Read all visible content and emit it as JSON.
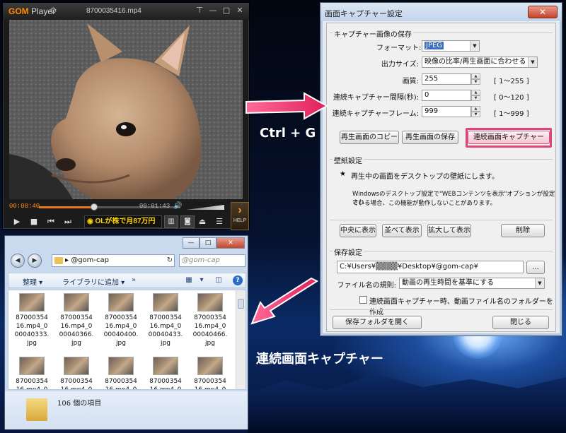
{
  "player": {
    "logo": "GOM",
    "logo_suffix": "Player",
    "filename": "8700035416.mp4",
    "time_current": "00:00:40",
    "time_total": "00:01:43",
    "progress": 0.39,
    "ad_text": "OLが株で月87万円",
    "help_label": "HELP"
  },
  "dialog": {
    "title": "画面キャプチャー設定",
    "close": "✕",
    "group_save_image": "キャプチャー画像の保存",
    "format_label": "フォーマット:",
    "format_value": "JPEG",
    "size_label": "出力サイズ:",
    "size_value": "映像の比率/再生画面に合わせる",
    "quality_label": "画質:",
    "quality_value": "255",
    "quality_range": "[ 1～255 ]",
    "interval_label": "連続キャプチャー間隔(秒):",
    "interval_value": "0",
    "interval_range": "[ 0～120 ]",
    "frames_label": "連続キャプチャーフレーム:",
    "frames_value": "999",
    "frames_range": "[ 1～999 ]",
    "btn_copy": "再生画面のコピー",
    "btn_save": "再生画面の保存",
    "btn_continuous": "連続画面キャプチャー",
    "group_wallpaper": "壁紙設定",
    "wallpaper_star": "★",
    "wallpaper_text": "再生中の画面をデスクトップの壁紙にします。",
    "wallpaper_note1": "Windowsのデスクトップ設定で\"WEBコンテンツを表示\"オプションが設定され",
    "wallpaper_note2": "ている場合、この機能が動作しないことがあります。",
    "btn_center": "中央に表示",
    "btn_tile": "並べて表示",
    "btn_stretch": "拡大して表示",
    "btn_delete": "削除",
    "group_save_settings": "保存設定",
    "path_value": "C:¥Users¥▒▒▒▒¥Desktop¥@gom-cap¥",
    "btn_browse": "...",
    "filename_rule_label": "ファイル名の規則:",
    "filename_rule_value": "動画の再生時間を基準にする",
    "create_folder_label": "連続画面キャプチャー時、動画ファイル名のフォルダーを作成",
    "btn_open_folder": "保存フォルダを開く",
    "btn_close": "閉じる"
  },
  "explorer": {
    "title_controls": [
      "—",
      "□",
      "✕"
    ],
    "address": "@gom-cap",
    "search_placeholder": "@gom-cap",
    "toolbar_organize": "整理",
    "toolbar_library": "ライブラリに追加",
    "files": [
      {
        "name": "8700035416.mp4_000040333.jpg"
      },
      {
        "name": "8700035416.mp4_000040366.jpg"
      },
      {
        "name": "8700035416.mp4_000040400.jpg"
      },
      {
        "name": "8700035416.mp4_000040433.jpg"
      },
      {
        "name": "8700035416.mp4_000040466.jpg"
      },
      {
        "name": "8700035416.mp4_"
      },
      {
        "name": "8700035416.mp4_"
      },
      {
        "name": "8700035416.mp4_"
      },
      {
        "name": "8700035416.mp4_"
      },
      {
        "name": "8700035416.mp4_"
      }
    ],
    "file_rows": [
      [
        "87000354",
        "16.mp4_0",
        "00040333.",
        "jpg"
      ],
      [
        "87000354",
        "16.mp4_0",
        "00040366.",
        "jpg"
      ],
      [
        "87000354",
        "16.mp4_0",
        "00040400.",
        "jpg"
      ],
      [
        "87000354",
        "16.mp4_0",
        "00040433.",
        "jpg"
      ],
      [
        "87000354",
        "16.mp4_0",
        "00040466.",
        "jpg"
      ],
      [
        "87000354",
        "16.mp4_0"
      ],
      [
        "87000354",
        "16.mp4_0"
      ],
      [
        "87000354",
        "16.mp4_0"
      ],
      [
        "87000354",
        "16.mp4_0"
      ],
      [
        "87000354",
        "16.mp4_0"
      ]
    ],
    "status": "106 個の項目"
  },
  "annotations": {
    "shortcut": "Ctrl + G",
    "caption": "連続画面キャプチャー",
    "arrow_color": "#e8336a"
  }
}
